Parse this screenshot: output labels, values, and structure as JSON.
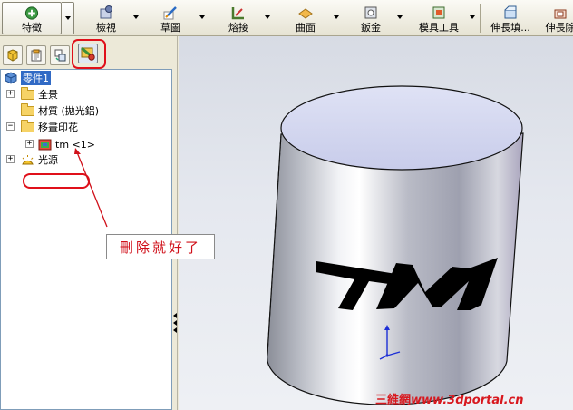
{
  "toolbar": {
    "buttons": [
      {
        "label": "特徵",
        "icon": "features-icon"
      },
      {
        "label": "檢視",
        "icon": "view-icon"
      },
      {
        "label": "草圖",
        "icon": "sketch-icon"
      },
      {
        "label": "熔接",
        "icon": "weldments-icon"
      },
      {
        "label": "曲面",
        "icon": "surfaces-icon"
      },
      {
        "label": "鈑金",
        "icon": "sheet-metal-icon"
      },
      {
        "label": "模具工具",
        "icon": "mold-tools-icon"
      },
      {
        "label": "伸長填...",
        "icon": "extruded-fill-icon"
      },
      {
        "label": "伸長除",
        "icon": "extruded-cut-icon"
      }
    ]
  },
  "panel_tabs": [
    {
      "name": "feature-manager-tab",
      "icon": "feature-tree-icon"
    },
    {
      "name": "property-manager-tab",
      "icon": "property-icon"
    },
    {
      "name": "configuration-manager-tab",
      "icon": "configuration-icon"
    },
    {
      "name": "display-manager-tab",
      "icon": "display-manager-icon"
    }
  ],
  "tree": {
    "root": "零件1",
    "items": [
      {
        "label": "全景",
        "expander": "+"
      },
      {
        "label": "材質 (拋光鋁)",
        "expander": ""
      },
      {
        "label": "移畫印花",
        "expander": "−"
      },
      {
        "label": "tm <1>",
        "expander": "+"
      },
      {
        "label": "光源",
        "expander": "+"
      }
    ]
  },
  "viewport": {
    "decal_text": "TM"
  },
  "annotation": {
    "text": "刪除就好了"
  },
  "watermark": {
    "cn": "三維網",
    "url": "www.3dportal.cn"
  },
  "colors": {
    "highlight_red": "#e0101a",
    "tree_selection": "#316ac5",
    "cylinder_top": "#cfd3ef"
  }
}
